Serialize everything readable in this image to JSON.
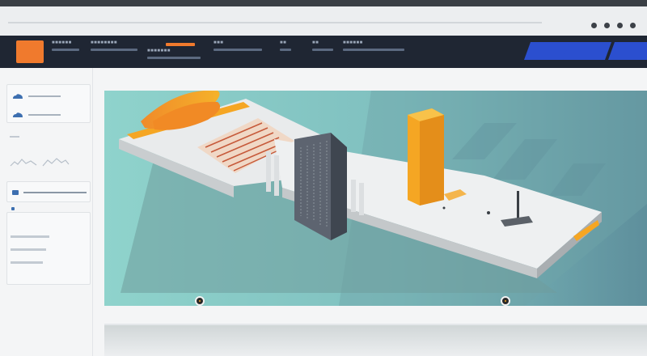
{
  "browser": {
    "window_controls": [
      "minimize-dot",
      "restore-dot",
      "maximize-dot",
      "close-dot"
    ]
  },
  "navbar": {
    "logo_color": "#f07a2d",
    "items": [
      {
        "label": "■■■■■■"
      },
      {
        "label": "■■■■■■■■"
      },
      {
        "label": "■■■■■■■"
      },
      {
        "label": "■■■"
      },
      {
        "label": "■■"
      },
      {
        "label": "■■"
      },
      {
        "label": "■■■■■■"
      }
    ],
    "tabs": [
      {
        "label": ""
      },
      {
        "label": ""
      },
      {
        "label": ""
      }
    ],
    "tab_color": "#2b4fcf"
  },
  "sidebar": {
    "items": [
      {
        "icon": "cloud-icon"
      },
      {
        "icon": "cloud-icon"
      },
      {
        "icon": "chart-icon"
      },
      {
        "icon": "slider-icon"
      },
      {
        "icon": "list-icon"
      }
    ]
  },
  "viewport": {
    "background": "#8fcfcb",
    "accent": "#f5a623"
  }
}
